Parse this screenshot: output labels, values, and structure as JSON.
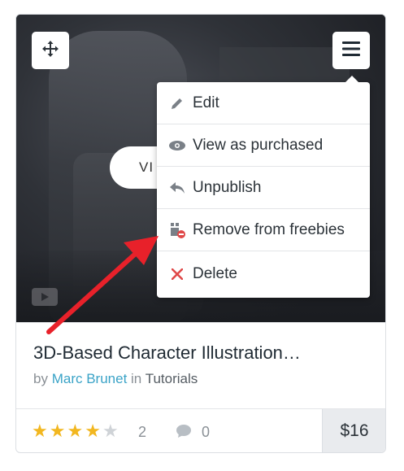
{
  "card": {
    "view_button_label": "VI",
    "title": "3D-Based Character Illustration…",
    "byline": {
      "by": "by",
      "author": "Marc Brunet",
      "in": "in",
      "category": "Tutorials"
    },
    "rating": {
      "stars_filled": 4,
      "stars_total": 5,
      "count": "2"
    },
    "comments": {
      "count": "0"
    },
    "price": "$16"
  },
  "menu": {
    "items": [
      {
        "label": "Edit",
        "icon": "pencil-icon"
      },
      {
        "label": "View as purchased",
        "icon": "eye-icon"
      },
      {
        "label": "Unpublish",
        "icon": "reply-icon"
      },
      {
        "label": "Remove from freebies",
        "icon": "remove-freebie-icon"
      },
      {
        "label": "Delete",
        "icon": "x-icon"
      }
    ]
  },
  "colors": {
    "accent_link": "#3aa3c7",
    "star": "#f2b720",
    "delete_red": "#e04848",
    "annotation_arrow": "#e8212a"
  }
}
